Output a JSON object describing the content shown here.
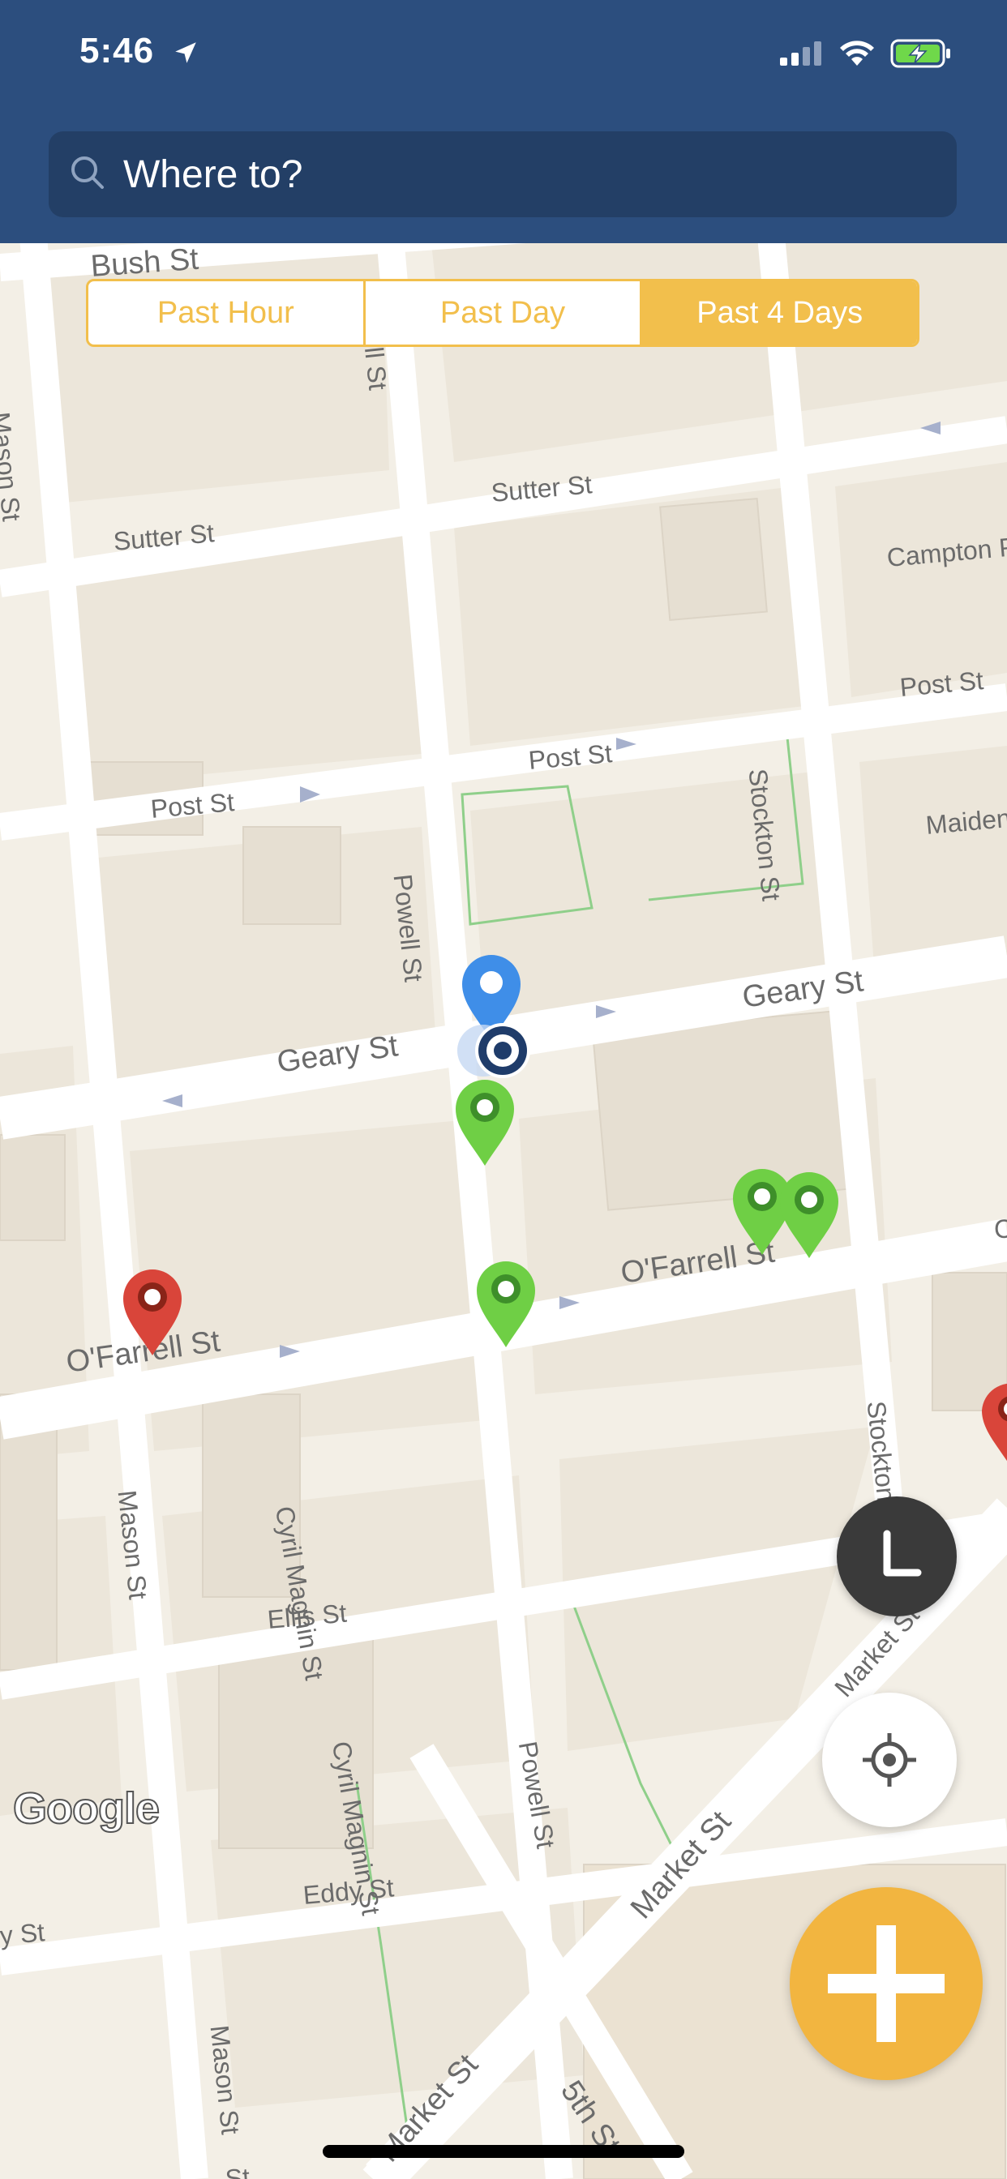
{
  "status_bar": {
    "time": "5:46"
  },
  "search": {
    "placeholder": "Where to?"
  },
  "segmented_control": {
    "options": [
      {
        "label": "Past Hour",
        "active": false
      },
      {
        "label": "Past Day",
        "active": false
      },
      {
        "label": "Past 4 Days",
        "active": true
      }
    ]
  },
  "map": {
    "streets": [
      "Bush St",
      "Powell St",
      "Mason St",
      "Sutter St",
      "Sutter St",
      "Campton Pl",
      "Post St",
      "Post St",
      "Post St",
      "Stockton St",
      "Maiden",
      "Powell St",
      "Geary St",
      "Geary St",
      "O'Farrell St",
      "O'Farrell St",
      "Stockton St",
      "Mason St",
      "Cyril Magnin St",
      "Cyril Magnin St",
      "Ellis St",
      "Powell St",
      "Market St",
      "Market St",
      "Eddy St",
      "Mason St",
      "Market St",
      "5th St",
      "y St",
      "St",
      "C"
    ],
    "attribution": "Google"
  },
  "colors": {
    "header": "#2c4e7e",
    "accent": "#f2bf4c",
    "pin_green": "#6fcf45",
    "pin_red": "#d9453a",
    "pin_blue": "#3f8ee8"
  },
  "icons": {
    "search": "search-icon",
    "history": "clock-icon",
    "locate": "crosshair-icon",
    "add": "plus-icon"
  }
}
